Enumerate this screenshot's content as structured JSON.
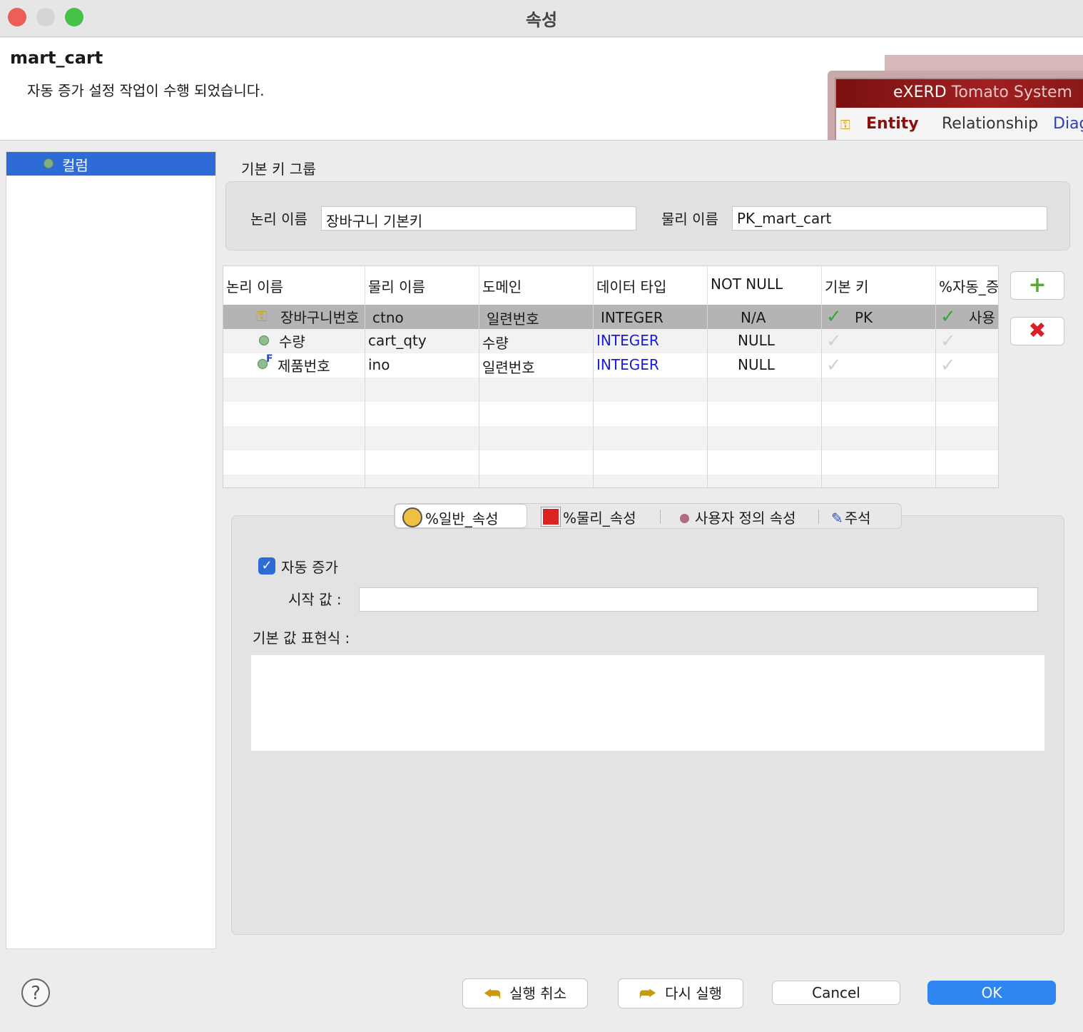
{
  "window": {
    "title": "속성"
  },
  "header": {
    "title": "mart_cart",
    "message": "자동 증가 설정 작업이 수행 되었습니다.",
    "banner": {
      "app": "eXERD",
      "company": "Tomato System",
      "tabs": [
        "Entity",
        "Relationship",
        "Diag"
      ]
    }
  },
  "nav": {
    "items": [
      {
        "label": "컬럼"
      }
    ]
  },
  "pk_group": {
    "title": "기본 키 그룹",
    "logical_label": "논리 이름",
    "logical_value": "장바구니 기본키",
    "physical_label": "물리 이름",
    "physical_value": "PK_mart_cart"
  },
  "table": {
    "headers": [
      "논리 이름",
      "물리 이름",
      "도메인",
      "데이터 타입",
      "NOT NULL",
      "기본 키",
      "%자동_증"
    ],
    "rows": [
      {
        "icon": "key-icon",
        "logical": "장바구니번호",
        "physical": "ctno",
        "domain": "일련번호",
        "type": "INTEGER",
        "not_null": "N/A",
        "pk": "PK",
        "auto": "사용"
      },
      {
        "icon": "attribute-icon",
        "logical": "수량",
        "physical": "cart_qty",
        "domain": "수량",
        "type": "INTEGER",
        "not_null": "NULL",
        "pk": "",
        "auto": ""
      },
      {
        "icon": "foreign-key-icon",
        "logical": "제품번호",
        "physical": "ino",
        "domain": "일련번호",
        "type": "INTEGER",
        "not_null": "NULL",
        "pk": "",
        "auto": ""
      }
    ],
    "add_icon": "plus-icon",
    "delete_icon": "delete-icon"
  },
  "tabs": {
    "items": [
      "%일반_속성",
      "%물리_속성",
      "사용자 정의 속성",
      "주석"
    ],
    "active": "%일반_속성"
  },
  "general": {
    "auto_increment_label": "자동 증가",
    "auto_increment_checked": true,
    "start_value_label": "시작 값 :",
    "start_value": "",
    "default_expr_label": "기본 값 표현식 :",
    "default_expr": ""
  },
  "buttons": {
    "undo": "실행 취소",
    "redo": "다시 실행",
    "cancel": "Cancel",
    "ok": "OK"
  },
  "colors": {
    "accent": "#2f6bd6",
    "ok_button": "#2f86f0",
    "type_blue": "#1a1adc"
  }
}
